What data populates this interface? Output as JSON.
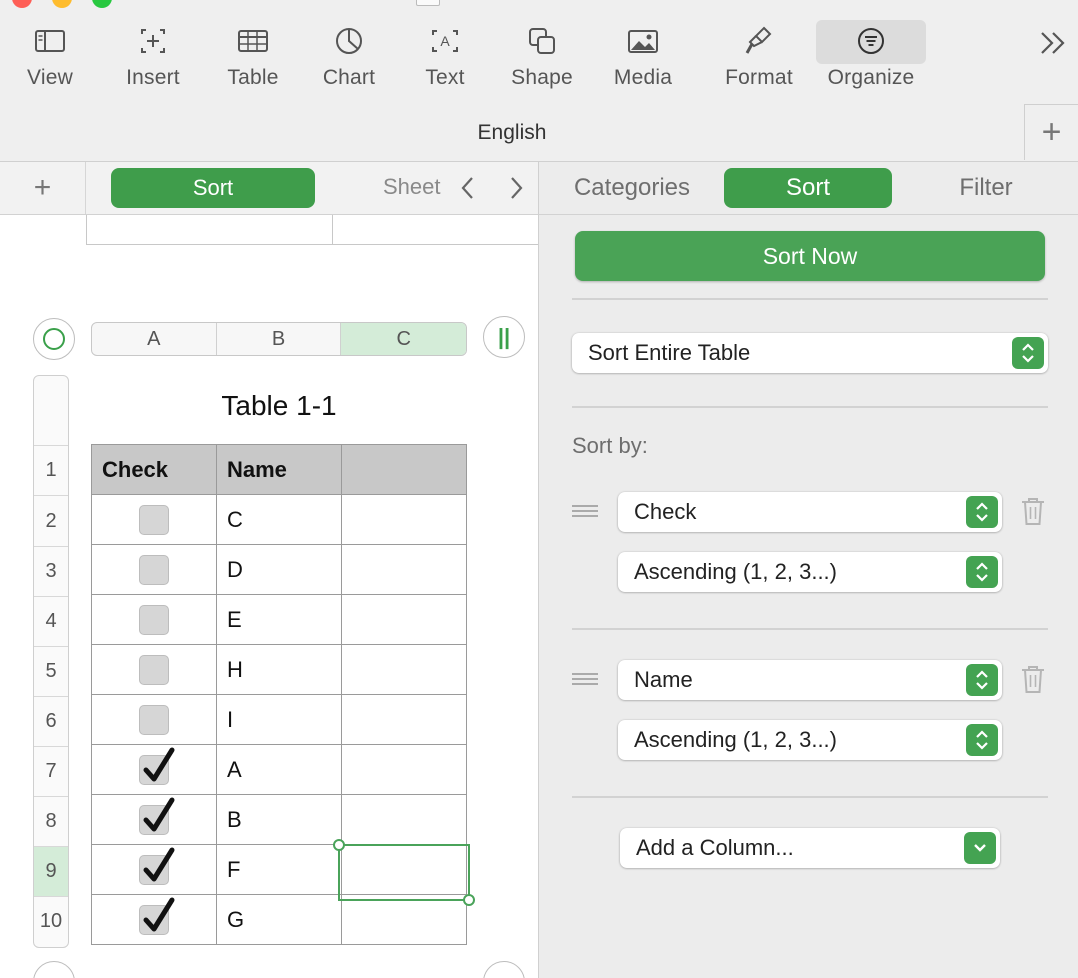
{
  "toolbar": {
    "buttons": [
      {
        "label": "View",
        "icon": "sidebar-icon"
      },
      {
        "label": "Insert",
        "icon": "insert-icon"
      },
      {
        "label": "Table",
        "icon": "table-icon"
      },
      {
        "label": "Chart",
        "icon": "chart-icon"
      },
      {
        "label": "Text",
        "icon": "text-box-icon"
      },
      {
        "label": "Shape",
        "icon": "shape-icon"
      },
      {
        "label": "Media",
        "icon": "media-icon"
      },
      {
        "label": "Format",
        "icon": "paintbrush-icon"
      },
      {
        "label": "Organize",
        "icon": "organize-icon"
      }
    ],
    "active_button": "Organize",
    "language": "English"
  },
  "sheet_tabs": {
    "active": "Sort",
    "other": "Sheet"
  },
  "table": {
    "title": "Table 1-1",
    "column_letters": [
      "A",
      "B",
      "C"
    ],
    "selected_column": "C",
    "header": [
      "Check",
      "Name",
      ""
    ],
    "rows": [
      {
        "num": "2",
        "checked": false,
        "name": "C"
      },
      {
        "num": "3",
        "checked": false,
        "name": "D"
      },
      {
        "num": "4",
        "checked": false,
        "name": "E"
      },
      {
        "num": "5",
        "checked": false,
        "name": "H"
      },
      {
        "num": "6",
        "checked": false,
        "name": "I"
      },
      {
        "num": "7",
        "checked": true,
        "name": "A"
      },
      {
        "num": "8",
        "checked": true,
        "name": "B"
      },
      {
        "num": "9",
        "checked": true,
        "name": "F"
      },
      {
        "num": "10",
        "checked": true,
        "name": "G"
      }
    ],
    "header_row_num": "1",
    "selected_row": "9"
  },
  "inspector": {
    "tabs": [
      "Categories",
      "Sort",
      "Filter"
    ],
    "active_tab": "Sort",
    "sort_now": "Sort Now",
    "scope": "Sort Entire Table",
    "sort_by_label": "Sort by:",
    "rules": [
      {
        "column": "Check",
        "order": "Ascending (1, 2, 3...)"
      },
      {
        "column": "Name",
        "order": "Ascending (1, 2, 3...)"
      }
    ],
    "add_column": "Add a Column..."
  },
  "colors": {
    "accent": "#3f9d4b",
    "selection_fill": "#d4ecd8",
    "header_fill": "#c8c8c8"
  }
}
